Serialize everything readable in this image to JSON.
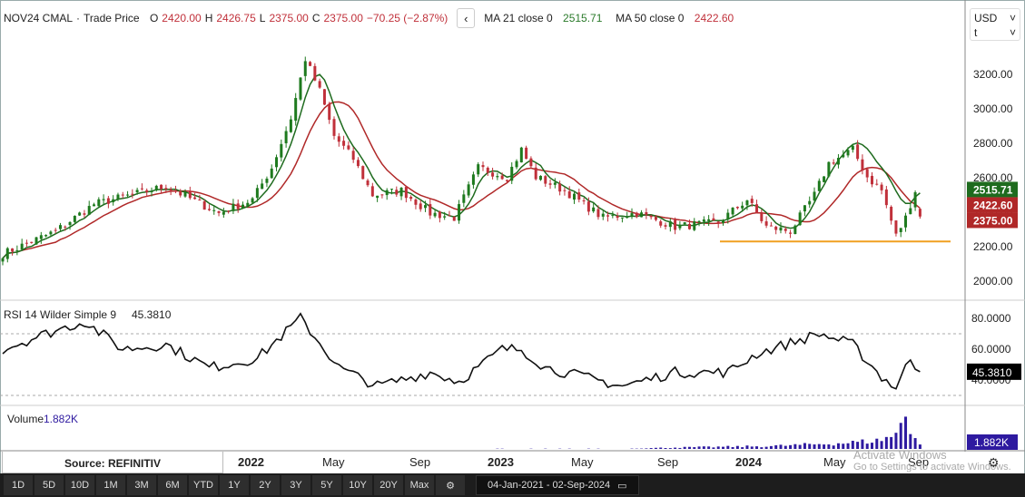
{
  "header": {
    "symbol": "NOV24 CMAL",
    "sep": "·",
    "type": "Trade Price",
    "o_label": "O",
    "open": "2420.00",
    "h_label": "H",
    "high": "2426.75",
    "l_label": "L",
    "low": "2375.00",
    "c_label": "C",
    "close": "2375.00",
    "change": "−70.25 (−2.87%)",
    "ma21_label": "MA 21 close 0",
    "ma21": "2515.71",
    "ma50_label": "MA 50 close 0",
    "ma50": "2422.60"
  },
  "currency": {
    "value": "USD",
    "unit": "t"
  },
  "price_axis": {
    "ticks": [
      "3200.00",
      "3000.00",
      "2800.00",
      "2600.00",
      "2400.00",
      "2200.00",
      "2000.00"
    ],
    "tags": {
      "ma21": "2515.71",
      "ma50": "2422.60",
      "close": "2375.00"
    }
  },
  "rsi": {
    "label": "RSI 14 Wilder Simple 9",
    "value": "45.3810",
    "ticks": [
      "80.0000",
      "60.0000",
      "40.0000"
    ]
  },
  "volume": {
    "label": "Volume",
    "value": "1.882K"
  },
  "colors": {
    "up": "#1e7a1e",
    "down": "#c0303a",
    "ma21": "#1e6b1e",
    "ma50": "#b02828",
    "support": "#f0a020",
    "volume": "#2e1aa0"
  },
  "chart_data": {
    "type": "candlestick",
    "weeks": 192,
    "start": "04-Jan-2021",
    "end": "02-Sep-2024",
    "close_keypoints": [
      [
        0,
        2158
      ],
      [
        11,
        2290
      ],
      [
        19,
        2447
      ],
      [
        34,
        2550
      ],
      [
        45,
        2395
      ],
      [
        52,
        2473
      ],
      [
        56,
        2658
      ],
      [
        60,
        2947
      ],
      [
        63,
        3290
      ],
      [
        66,
        3105
      ],
      [
        69,
        2842
      ],
      [
        73,
        2710
      ],
      [
        77,
        2500
      ],
      [
        83,
        2526
      ],
      [
        89,
        2395
      ],
      [
        94,
        2368
      ],
      [
        99,
        2658
      ],
      [
        105,
        2605
      ],
      [
        108,
        2763
      ],
      [
        111,
        2605
      ],
      [
        117,
        2526
      ],
      [
        125,
        2368
      ],
      [
        132,
        2395
      ],
      [
        140,
        2316
      ],
      [
        149,
        2342
      ],
      [
        155,
        2473
      ],
      [
        159,
        2316
      ],
      [
        164,
        2290
      ],
      [
        169,
        2500
      ],
      [
        172,
        2684
      ],
      [
        177,
        2763
      ],
      [
        180,
        2605
      ],
      [
        183,
        2526
      ],
      [
        186,
        2263
      ],
      [
        188,
        2368
      ],
      [
        190,
        2526
      ],
      [
        191,
        2375
      ]
    ],
    "rsi_keypoints": [
      [
        0,
        60
      ],
      [
        8,
        69
      ],
      [
        17,
        78
      ],
      [
        25,
        60
      ],
      [
        34,
        63
      ],
      [
        43,
        48
      ],
      [
        53,
        54
      ],
      [
        62,
        80
      ],
      [
        70,
        48
      ],
      [
        78,
        36
      ],
      [
        89,
        45
      ],
      [
        95,
        39
      ],
      [
        104,
        60
      ],
      [
        108,
        60
      ],
      [
        113,
        48
      ],
      [
        129,
        36
      ],
      [
        140,
        45
      ],
      [
        151,
        45
      ],
      [
        157,
        57
      ],
      [
        170,
        70
      ],
      [
        177,
        63
      ],
      [
        183,
        42
      ],
      [
        186,
        35
      ],
      [
        189,
        54
      ],
      [
        191,
        45.38
      ]
    ],
    "volume_keypoints": [
      [
        0,
        0.05
      ],
      [
        130,
        0.1
      ],
      [
        140,
        0.6
      ],
      [
        160,
        1.2
      ],
      [
        175,
        2.5
      ],
      [
        182,
        3.5
      ],
      [
        186,
        6
      ],
      [
        188,
        16
      ],
      [
        189,
        9
      ],
      [
        190,
        5
      ],
      [
        191,
        1.882
      ]
    ],
    "support_level": 2230,
    "price_ylim": [
      2000,
      3200
    ],
    "rsi_ylim": [
      30,
      80
    ],
    "rsi_bands": [
      70,
      30
    ]
  },
  "x_axis": [
    "2022",
    "May",
    "Sep",
    "2023",
    "May",
    "Sep",
    "2024",
    "May",
    "Sep"
  ],
  "source": "Source: REFINITIV",
  "watermark": {
    "title": "Activate Windows",
    "sub": "Go to Settings to activate Windows."
  },
  "toolbar": {
    "periods": [
      "1D",
      "5D",
      "10D",
      "1M",
      "3M",
      "6M",
      "YTD",
      "1Y",
      "2Y",
      "3Y",
      "5Y",
      "10Y",
      "20Y",
      "Max"
    ],
    "date_range": "04-Jan-2021  -  02-Sep-2024"
  }
}
